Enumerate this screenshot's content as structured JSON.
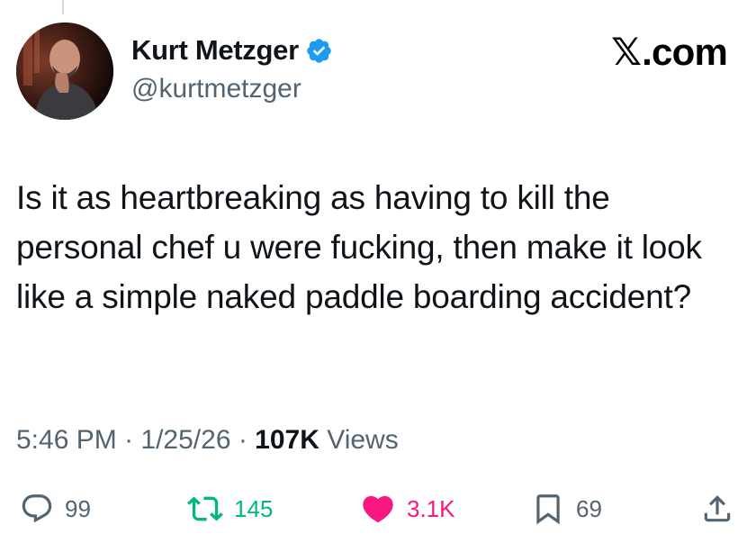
{
  "author": {
    "display_name": "Kurt Metzger",
    "handle": "@kurtmetzger",
    "verified": true,
    "verified_color": "#1d9bf0"
  },
  "brand": {
    "logo_mark": "𝕏",
    "logo_text": ".com"
  },
  "tweet": {
    "text": "Is it as heartbreaking as having to kill the personal chef u were fucking, then make it look like a simple naked paddle boarding accident?"
  },
  "meta": {
    "time": "5:46 PM",
    "separator": " · ",
    "date": "1/25/26",
    "views_count": "107K",
    "views_label": " Views"
  },
  "actions": {
    "reply": {
      "icon": "reply-icon",
      "count": "99"
    },
    "retweet": {
      "icon": "retweet-icon",
      "count": "145",
      "color": "#00ba7c"
    },
    "like": {
      "icon": "heart-icon",
      "count": "3.1K",
      "color": "#f91880"
    },
    "bookmark": {
      "icon": "bookmark-icon",
      "count": "69"
    },
    "share": {
      "icon": "share-icon"
    }
  },
  "colors": {
    "text_primary": "#0f1419",
    "text_secondary": "#536471"
  }
}
